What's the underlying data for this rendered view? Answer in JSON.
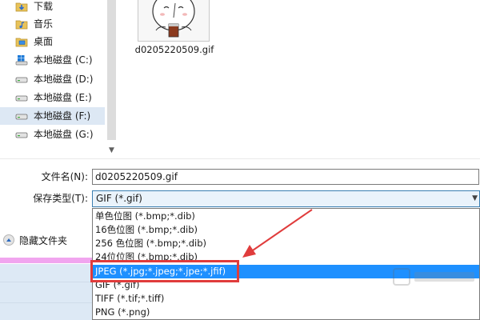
{
  "nav_pane": {
    "items": [
      {
        "label": "下载",
        "icon": "download-folder-icon"
      },
      {
        "label": "音乐",
        "icon": "music-folder-icon"
      },
      {
        "label": "桌面",
        "icon": "desktop-folder-icon"
      },
      {
        "label": "本地磁盘 (C:)",
        "icon": "windows-drive-icon"
      },
      {
        "label": "本地磁盘 (D:)",
        "icon": "drive-icon"
      },
      {
        "label": "本地磁盘 (E:)",
        "icon": "drive-icon"
      },
      {
        "label": "本地磁盘 (F:)",
        "icon": "drive-icon",
        "selected": true
      },
      {
        "label": "本地磁盘 (G:)",
        "icon": "drive-icon"
      }
    ]
  },
  "file_area": {
    "files": [
      {
        "name": "d0205220509.gif",
        "thumbnail": "cartoon-character-drinking-thumbnail"
      }
    ]
  },
  "form": {
    "filename_label": "文件名(N):",
    "filename_value": "d0205220509.gif",
    "type_label": "保存类型(T):",
    "type_value": "GIF (*.gif)",
    "hide_folders_label": "隐藏文件夹"
  },
  "dropdown": {
    "options": [
      {
        "label": "单色位图 (*.bmp;*.dib)"
      },
      {
        "label": "16色位图 (*.bmp;*.dib)"
      },
      {
        "label": "256 色位图 (*.bmp;*.dib)"
      },
      {
        "label": "24位位图 (*.bmp;*.dib)"
      },
      {
        "label": "JPEG (*.jpg;*.jpeg;*.jpe;*.jfif)",
        "highlighted": true
      },
      {
        "label": "GIF (*.gif)"
      },
      {
        "label": "TIFF (*.tif;*.tiff)"
      },
      {
        "label": "PNG (*.png)"
      }
    ]
  },
  "colors": {
    "highlight": "#1e90ff",
    "annotation": "#e03c3c",
    "selected_nav": "#dde8f4"
  }
}
